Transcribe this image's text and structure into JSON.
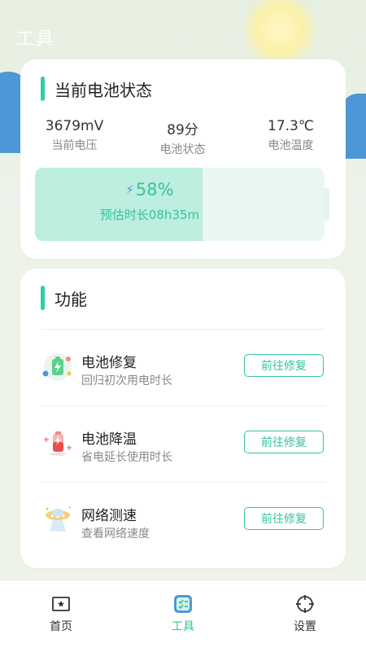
{
  "page": {
    "title": "工具"
  },
  "battery_card": {
    "title": "当前电池状态",
    "stats": [
      {
        "value": "3679mV",
        "label": "当前电压"
      },
      {
        "value": "89分",
        "label": "电池状态"
      },
      {
        "value": "17.3℃",
        "label": "电池温度"
      }
    ],
    "level_percent": "58%",
    "level_fraction": 0.58,
    "estimate": "预估时长08h35m"
  },
  "features_card": {
    "title": "功能",
    "items": [
      {
        "name": "电池修复",
        "desc": "回归初次用电时长",
        "button": "前往修复",
        "icon": "battery-repair-icon"
      },
      {
        "name": "电池降温",
        "desc": "省电延长使用时长",
        "button": "前往修复",
        "icon": "battery-cooling-icon"
      },
      {
        "name": "网络测速",
        "desc": "查看网络速度",
        "button": "前往修复",
        "icon": "network-speed-icon"
      }
    ]
  },
  "tabbar": {
    "tabs": [
      {
        "label": "首页",
        "icon": "home-icon"
      },
      {
        "label": "工具",
        "icon": "tools-icon",
        "active": true
      },
      {
        "label": "设置",
        "icon": "settings-icon"
      }
    ]
  },
  "colors": {
    "accent": "#36c29e",
    "accent_bar": "#2fcfa8",
    "battery_fill": "#bdeee0",
    "sky_blue": "#4e97d6"
  }
}
